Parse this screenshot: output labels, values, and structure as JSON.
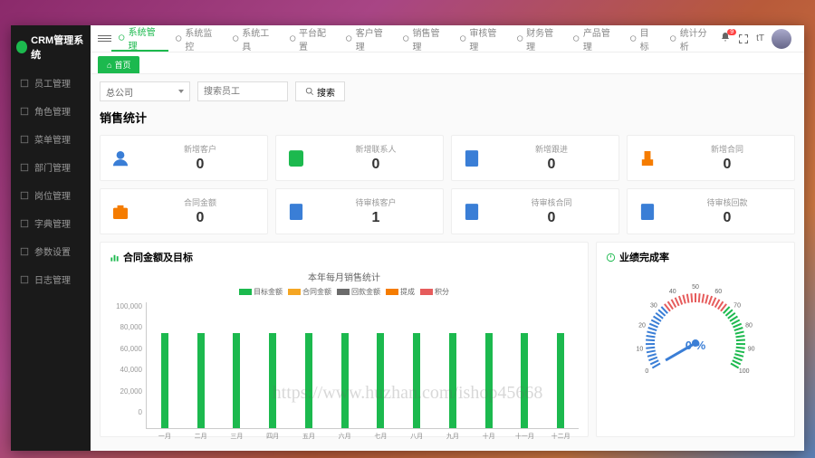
{
  "app_title": "CRM管理系统",
  "sidebar": {
    "items": [
      {
        "label": "员工管理"
      },
      {
        "label": "角色管理"
      },
      {
        "label": "菜单管理"
      },
      {
        "label": "部门管理"
      },
      {
        "label": "岗位管理"
      },
      {
        "label": "字典管理"
      },
      {
        "label": "参数设置"
      },
      {
        "label": "日志管理"
      }
    ]
  },
  "topnav": {
    "items": [
      {
        "label": "系统管理",
        "active": true
      },
      {
        "label": "系统监控"
      },
      {
        "label": "系统工具"
      },
      {
        "label": "平台配置"
      },
      {
        "label": "客户管理"
      },
      {
        "label": "销售管理"
      },
      {
        "label": "审核管理"
      },
      {
        "label": "财务管理"
      },
      {
        "label": "产品管理"
      },
      {
        "label": "目标"
      },
      {
        "label": "统计分析"
      }
    ],
    "notif_count": "9"
  },
  "tab": {
    "label": "首页"
  },
  "filters": {
    "company": "总公司",
    "search_placeholder": "搜索员工",
    "btn": "搜索"
  },
  "stats_title": "销售统计",
  "stats": [
    {
      "label": "新增客户",
      "value": "0",
      "icon": "user",
      "color": "#3a7ed6"
    },
    {
      "label": "新增联系人",
      "value": "0",
      "icon": "contacts",
      "color": "#1cb94e"
    },
    {
      "label": "新增跟进",
      "value": "0",
      "icon": "doc",
      "color": "#3a7ed6"
    },
    {
      "label": "新增合同",
      "value": "0",
      "icon": "stamp",
      "color": "#f57c00"
    },
    {
      "label": "合同金额",
      "value": "0",
      "icon": "briefcase",
      "color": "#f57c00"
    },
    {
      "label": "待审核客户",
      "value": "1",
      "icon": "doc",
      "color": "#3a7ed6"
    },
    {
      "label": "待审核合同",
      "value": "0",
      "icon": "doc",
      "color": "#3a7ed6"
    },
    {
      "label": "待审核回款",
      "value": "0",
      "icon": "doc",
      "color": "#3a7ed6"
    }
  ],
  "panel_left": {
    "title": "合同金额及目标"
  },
  "panel_right": {
    "title": "业绩完成率"
  },
  "gauge": {
    "value_text": "0 %",
    "ticks": [
      "0",
      "10",
      "20",
      "30",
      "40",
      "50",
      "60",
      "70",
      "80",
      "90",
      "100"
    ]
  },
  "watermark": "https://www.huzhan.com/ishop45668",
  "chart_data": {
    "type": "bar",
    "title": "本年每月销售统计",
    "legend": [
      {
        "name": "目标金额",
        "color": "#1cb94e"
      },
      {
        "name": "合同金额",
        "color": "#f5a623"
      },
      {
        "name": "回款金额",
        "color": "#6b6b6b"
      },
      {
        "name": "提成",
        "color": "#f57c00"
      },
      {
        "name": "积分",
        "color": "#e65c5c"
      }
    ],
    "categories": [
      "一月",
      "二月",
      "三月",
      "四月",
      "五月",
      "六月",
      "七月",
      "八月",
      "九月",
      "十月",
      "十一月",
      "十二月"
    ],
    "series": [
      {
        "name": "目标金额",
        "values": [
          83000,
          83000,
          83000,
          83000,
          83000,
          83000,
          83000,
          83000,
          83000,
          83000,
          83000,
          83000
        ]
      },
      {
        "name": "合同金额",
        "values": [
          0,
          0,
          0,
          0,
          0,
          0,
          0,
          0,
          0,
          0,
          0,
          0
        ]
      },
      {
        "name": "回款金额",
        "values": [
          0,
          0,
          0,
          0,
          0,
          0,
          0,
          0,
          0,
          0,
          0,
          0
        ]
      },
      {
        "name": "提成",
        "values": [
          0,
          0,
          0,
          0,
          0,
          0,
          0,
          0,
          0,
          0,
          0,
          0
        ]
      },
      {
        "name": "积分",
        "values": [
          0,
          0,
          0,
          0,
          0,
          0,
          0,
          0,
          0,
          0,
          0,
          0
        ]
      }
    ],
    "ylim": [
      0,
      100000
    ],
    "yticks": [
      "100,000",
      "80,000",
      "60,000",
      "40,000",
      "20,000",
      "0"
    ],
    "xlabel": "",
    "ylabel": ""
  }
}
